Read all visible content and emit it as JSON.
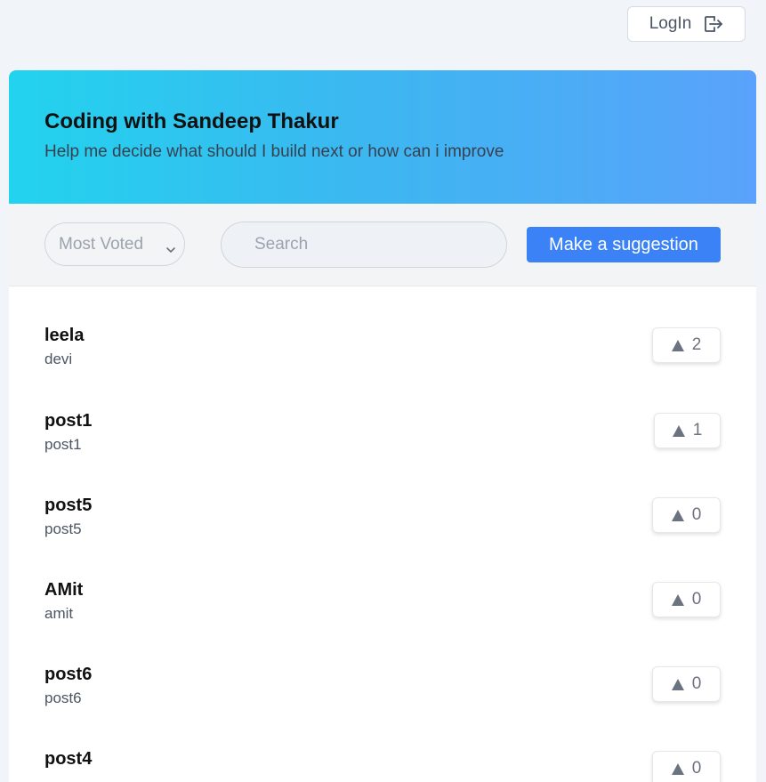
{
  "header": {
    "login_label": "LogIn",
    "login_icon": "logout-arrow-icon"
  },
  "hero": {
    "title": "Coding with Sandeep Thakur",
    "subtitle": "Help me decide what should I build next or how can i improve",
    "gradient": [
      "#22d3ee",
      "#5aa2fb"
    ]
  },
  "controls": {
    "sort_selected": "Most Voted",
    "search_placeholder": "Search",
    "search_value": "",
    "suggest_label": "Make a suggestion",
    "accent": "#3b82f6"
  },
  "posts": [
    {
      "title": "leela",
      "desc": "devi",
      "votes": "2"
    },
    {
      "title": "post1",
      "desc": "post1",
      "votes": "1"
    },
    {
      "title": "post5",
      "desc": "post5",
      "votes": "0"
    },
    {
      "title": "AMit",
      "desc": "amit",
      "votes": "0"
    },
    {
      "title": "post6",
      "desc": "post6",
      "votes": "0"
    },
    {
      "title": "post4",
      "desc": "",
      "votes": "0"
    }
  ]
}
